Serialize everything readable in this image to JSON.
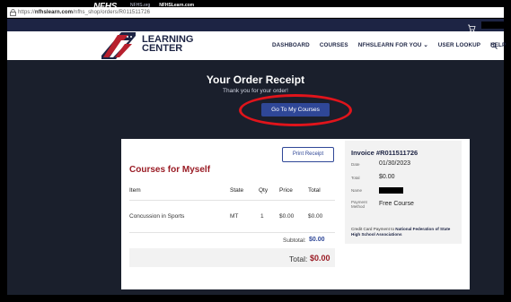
{
  "browser": {
    "url_prefix": "https://",
    "url_domain": "nfhslearn.com",
    "url_path": "/nfhs_shop/orders/R011511726"
  },
  "topbar": {
    "logo_text": "NFHS",
    "links": [
      "NFHS.org",
      "NFHSLearn.com"
    ]
  },
  "brand": {
    "line1": "LEARNING",
    "line2": "CENTER"
  },
  "nav": {
    "items": [
      "DASHBOARD",
      "COURSES",
      "NFHSLEARN FOR YOU",
      "USER LOOKUP",
      "HELP"
    ]
  },
  "hero": {
    "title": "Your Order Receipt",
    "subtitle": "Thank you for your order!",
    "button": "Go To My Courses"
  },
  "receipt": {
    "print_button": "Print Receipt",
    "section_title": "Courses for Myself",
    "columns": [
      "Item",
      "State",
      "Qty",
      "Price",
      "Total"
    ],
    "rows": [
      {
        "item": "Concussion in Sports",
        "state": "MT",
        "qty": "1",
        "price": "$0.00",
        "total": "$0.00"
      }
    ],
    "subtotal_label": "Subtotal:",
    "subtotal_value": "$0.00",
    "total_label": "Total:",
    "total_value": "$0.00"
  },
  "invoice": {
    "title": "Invoice #R011511726",
    "date_label": "Date",
    "date_value": "01/30/2023",
    "total_label": "Total",
    "total_value": "$0.00",
    "name_label": "Name",
    "payment_label_1": "Payment",
    "payment_label_2": "Method",
    "payment_value": "Free Course",
    "footer_prefix": "Credit Card Payment to ",
    "footer_org": "National Federation of State High School Associations"
  },
  "colors": {
    "navy": "#1d2444",
    "accent_blue": "#2f4797",
    "brand_red": "#9a1c25",
    "annotation_red": "#e0141b"
  }
}
